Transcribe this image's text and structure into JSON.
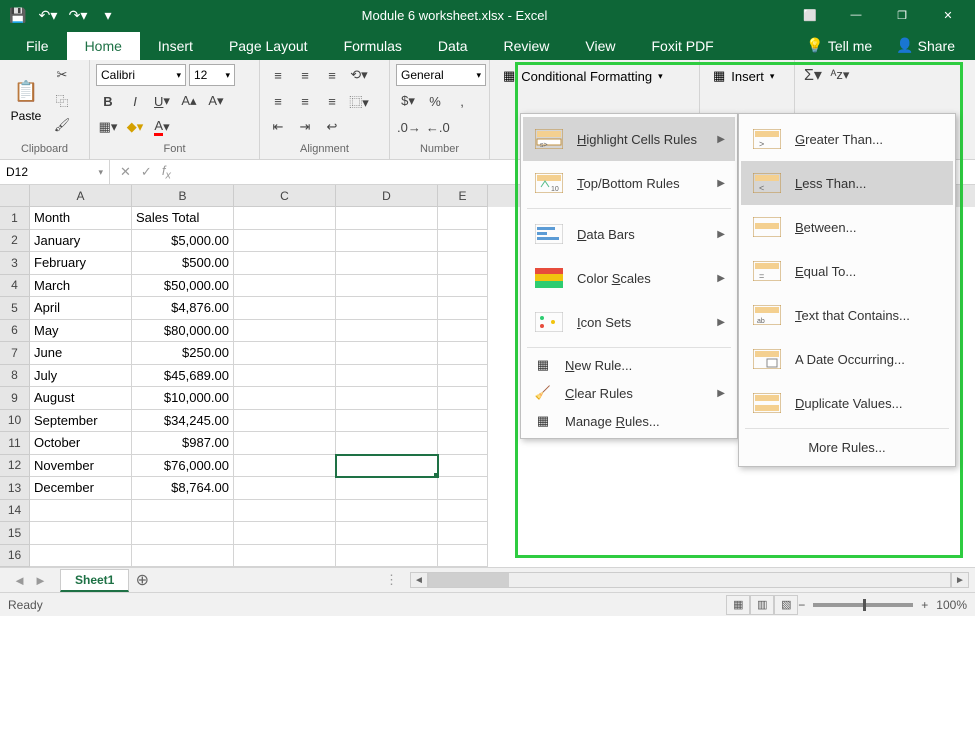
{
  "titlebar": {
    "title": "Module 6 worksheet.xlsx - Excel"
  },
  "tabs": {
    "file": "File",
    "home": "Home",
    "insert": "Insert",
    "pageLayout": "Page Layout",
    "formulas": "Formulas",
    "data": "Data",
    "review": "Review",
    "view": "View",
    "foxit": "Foxit PDF",
    "tellme": "Tell me",
    "share": "Share"
  },
  "ribbon": {
    "clipboard_label": "Clipboard",
    "paste": "Paste",
    "font_label": "Font",
    "font_name": "Calibri",
    "font_size": "12",
    "alignment_label": "Alignment",
    "number_label": "Number",
    "number_format": "General",
    "cond_fmt": "Conditional Formatting",
    "insert": "Insert"
  },
  "namebox": "D12",
  "columns": [
    "A",
    "B",
    "C",
    "D",
    "E"
  ],
  "data": {
    "header": {
      "a": "Month",
      "b": "Sales Total"
    },
    "rows": [
      {
        "a": "January",
        "b": "$5,000.00"
      },
      {
        "a": "February",
        "b": "$500.00"
      },
      {
        "a": "March",
        "b": "$50,000.00"
      },
      {
        "a": "April",
        "b": "$4,876.00"
      },
      {
        "a": "May",
        "b": "$80,000.00"
      },
      {
        "a": "June",
        "b": "$250.00"
      },
      {
        "a": "July",
        "b": "$45,689.00"
      },
      {
        "a": "August",
        "b": "$10,000.00"
      },
      {
        "a": "September",
        "b": "$34,245.00"
      },
      {
        "a": "October",
        "b": "$987.00"
      },
      {
        "a": "November",
        "b": "$76,000.00"
      },
      {
        "a": "December",
        "b": "$8,764.00"
      }
    ]
  },
  "cf_menu": {
    "highlight": "Highlight Cells Rules",
    "topbottom": "Top/Bottom Rules",
    "databars": "Data Bars",
    "colorscales": "Color Scales",
    "iconsets": "Icon Sets",
    "newrule": "New Rule...",
    "clear": "Clear Rules",
    "manage": "Manage Rules..."
  },
  "hcr_menu": {
    "greater": "Greater Than...",
    "less": "Less Than...",
    "between": "Between...",
    "equal": "Equal To...",
    "text": "Text that Contains...",
    "date": "A Date Occurring...",
    "dup": "Duplicate Values...",
    "more": "More Rules..."
  },
  "sheet": {
    "name": "Sheet1"
  },
  "status": {
    "ready": "Ready",
    "zoom": "100%"
  }
}
